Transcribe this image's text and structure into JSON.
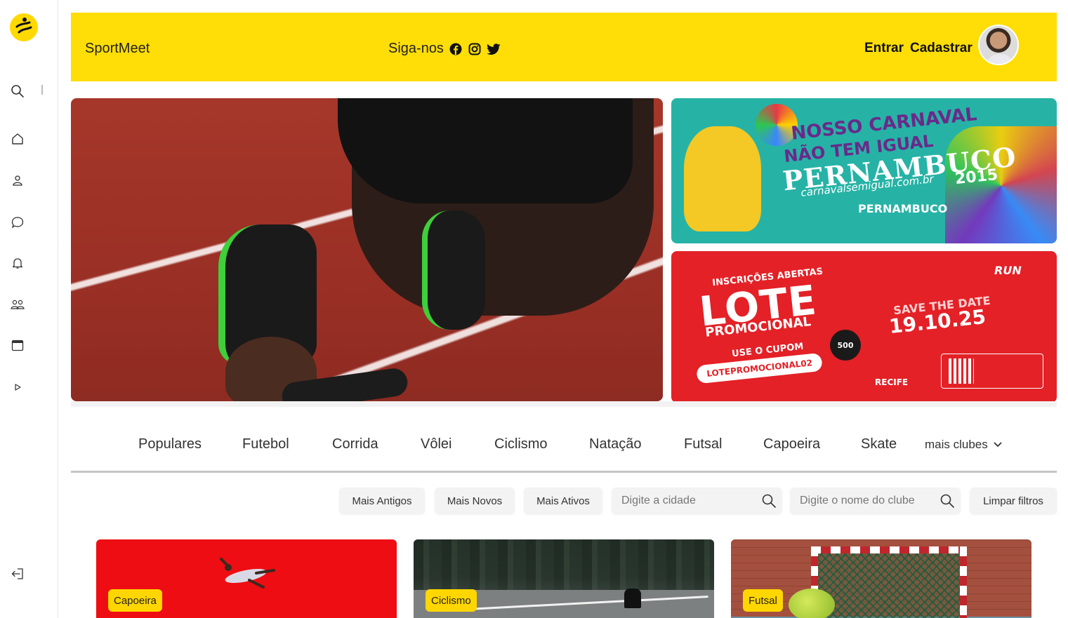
{
  "header": {
    "brand": "SportMeet",
    "follow_label": "Siga-nos",
    "social": [
      "facebook-icon",
      "instagram-icon",
      "twitter-icon"
    ],
    "login_label": "Entrar",
    "signup_label": "Cadastrar"
  },
  "sidebar": {
    "items": [
      "search-icon",
      "home-icon",
      "user-icon",
      "chat-icon",
      "bell-icon",
      "group-icon",
      "calendar-icon",
      "play-icon",
      "logout-icon"
    ]
  },
  "banners": {
    "carnaval": {
      "line1": "NOSSO CARNAVAL",
      "line2": "NÃO TEM IGUAL",
      "line3": "PERNAMBUCO",
      "site": "carnavalsemigual.com.br",
      "year": "2015",
      "org": "PERNAMBUCO"
    },
    "run": {
      "kicker": "INSCRIÇÕES ABERTAS",
      "title": "LOTE",
      "subtitle": "PROMOCIONAL",
      "coupon_label": "USE O CUPOM",
      "coupon_code": "LOTEPROMOCIONAL02",
      "badge": "500",
      "save_label": "SAVE THE DATE",
      "date": "19.10.25",
      "brand": "RUN",
      "sponsor": "RECIFE"
    }
  },
  "categories": {
    "tabs": [
      "Populares",
      "Futebol",
      "Corrida",
      "Vôlei",
      "Ciclismo",
      "Natação",
      "Futsal",
      "Capoeira",
      "Skate"
    ],
    "more_label": "mais clubes"
  },
  "filters": {
    "oldest": "Mais Antigos",
    "newest": "Mais Novos",
    "active": "Mais Ativos",
    "city_placeholder": "Digite a cidade",
    "club_placeholder": "Digite o nome do clube",
    "clear": "Limpar filtros"
  },
  "clubs": [
    {
      "tag": "Capoeira"
    },
    {
      "tag": "Ciclismo"
    },
    {
      "tag": "Futsal"
    }
  ],
  "colors": {
    "accent": "#ffde07",
    "tag": "#ffd600"
  }
}
